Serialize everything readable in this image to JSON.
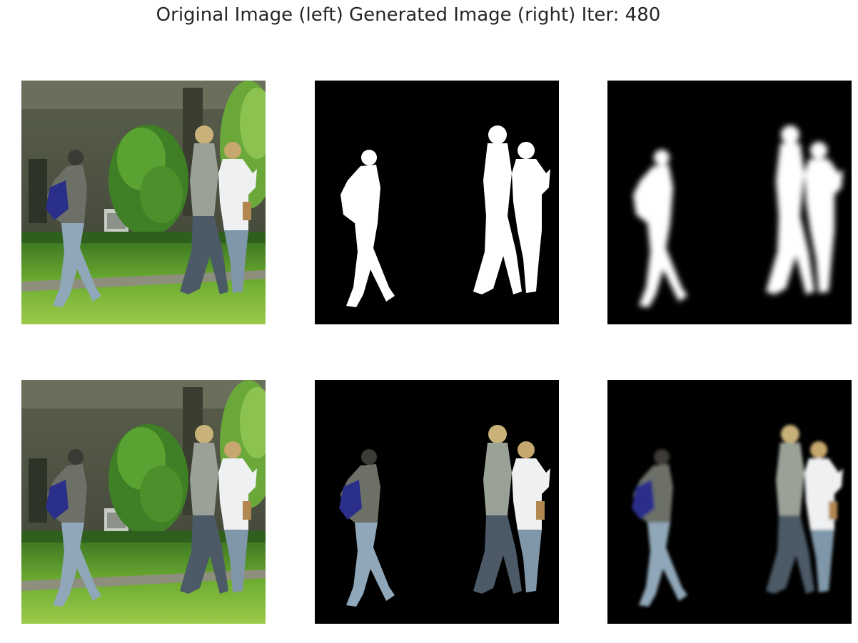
{
  "figure": {
    "title": "Original Image (left) Generated Image (right) Iter: 480"
  },
  "panels": [
    {
      "row": 1,
      "col": 1,
      "content": "original-photo"
    },
    {
      "row": 1,
      "col": 2,
      "content": "ground-truth-mask"
    },
    {
      "row": 1,
      "col": 3,
      "content": "generated-mask"
    },
    {
      "row": 2,
      "col": 1,
      "content": "original-photo"
    },
    {
      "row": 2,
      "col": 2,
      "content": "ground-truth-masked-photo"
    },
    {
      "row": 2,
      "col": 3,
      "content": "generated-masked-photo"
    }
  ],
  "iteration": 480,
  "colors": {
    "background": "#ffffff",
    "title_text": "#262626",
    "mask_background": "#000000",
    "mask_foreground": "#ffffff",
    "grass": "#5f9a2e",
    "building": "#4a4f3e",
    "shirt_blue": "#2a2f8a",
    "jeans": "#8fa7b8"
  }
}
